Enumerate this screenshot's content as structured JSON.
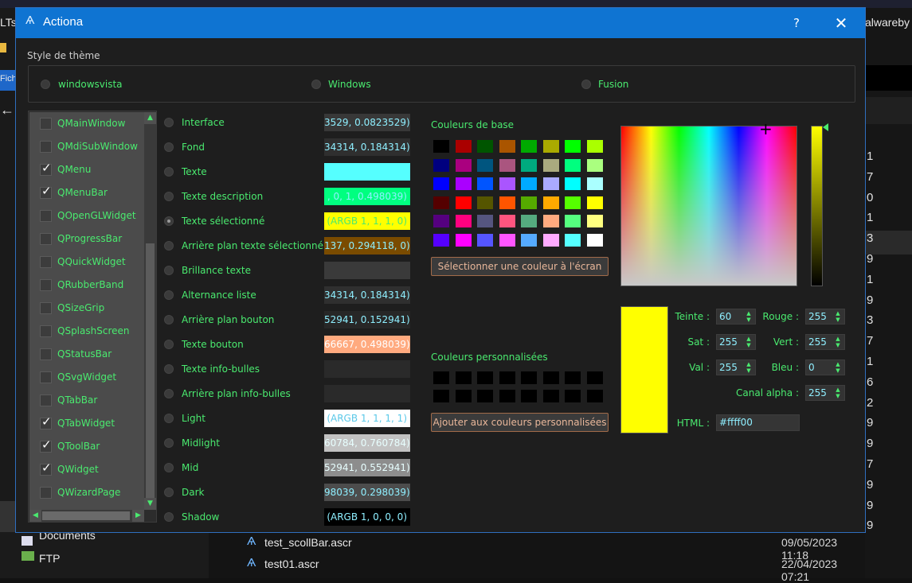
{
  "dialog": {
    "title": "Actiona",
    "help_label": "?",
    "close_label": "✕"
  },
  "theme": {
    "heading": "Style de thème",
    "options": [
      {
        "label": "windowsvista",
        "selected": false
      },
      {
        "label": "Windows",
        "selected": false
      },
      {
        "label": "Fusion",
        "selected": false
      }
    ]
  },
  "widgets": {
    "items": [
      {
        "label": "QMainWindow",
        "checked": false
      },
      {
        "label": "QMdiSubWindow",
        "checked": false
      },
      {
        "label": "QMenu",
        "checked": true
      },
      {
        "label": "QMenuBar",
        "checked": true
      },
      {
        "label": "QOpenGLWidget",
        "checked": false
      },
      {
        "label": "QProgressBar",
        "checked": false
      },
      {
        "label": "QQuickWidget",
        "checked": false
      },
      {
        "label": "QRubberBand",
        "checked": false
      },
      {
        "label": "QSizeGrip",
        "checked": false
      },
      {
        "label": "QSplashScreen",
        "checked": false
      },
      {
        "label": "QStatusBar",
        "checked": false
      },
      {
        "label": "QSvgWidget",
        "checked": false
      },
      {
        "label": "QTabBar",
        "checked": false
      },
      {
        "label": "QTabWidget",
        "checked": true
      },
      {
        "label": "QToolBar",
        "checked": true
      },
      {
        "label": "QWidget",
        "checked": true
      },
      {
        "label": "QWizardPage",
        "checked": false
      }
    ]
  },
  "roles": [
    {
      "label": "Interface",
      "value": "3529, 0.0823529)",
      "bg": "#383838",
      "fg": "#8fefff",
      "selected": false
    },
    {
      "label": "Fond",
      "value": "34314, 0.184314)",
      "bg": "#2f2f2f",
      "fg": "#8fefff",
      "selected": false
    },
    {
      "label": "Texte",
      "value": "",
      "bg": "#55ffff",
      "fg": "#8fefff",
      "selected": false
    },
    {
      "label": "Texte description",
      "value": ", 0, 1, 0.498039)",
      "bg": "#00ff80",
      "fg": "#8fefff",
      "selected": false
    },
    {
      "label": "Texte sélectionné",
      "value": "(ARGB 1, 1, 1, 0)",
      "bg": "#ffff00",
      "fg": "#4aea6f",
      "selected": true
    },
    {
      "label": "Arrière plan texte sélectionné",
      "value": "137, 0.294118, 0)",
      "bg": "#7a4b00",
      "fg": "#8fefff",
      "selected": false
    },
    {
      "label": "Brillance texte",
      "value": "",
      "bg": "#3a3a3a",
      "fg": "#8fefff",
      "selected": false
    },
    {
      "label": "Alternance liste",
      "value": "34314, 0.184314)",
      "bg": "#2f2f2f",
      "fg": "#8fefff",
      "selected": false
    },
    {
      "label": "Arrière plan bouton",
      "value": "52941, 0.152941)",
      "bg": "#272727",
      "fg": "#8fefff",
      "selected": false
    },
    {
      "label": "Texte bouton",
      "value": "66667, 0.498039)",
      "bg": "#ffaa7f",
      "fg": "#ffffff",
      "selected": false
    },
    {
      "label": "Texte info-bulles",
      "value": "",
      "bg": "#2a2a2a",
      "fg": "#8fefff",
      "selected": false
    },
    {
      "label": "Arrière plan info-bulles",
      "value": "",
      "bg": "#2a2a2a",
      "fg": "#8fefff",
      "selected": false
    },
    {
      "label": "Light",
      "value": "(ARGB 1, 1, 1, 1)",
      "bg": "#ffffff",
      "fg": "#5ac8e8",
      "selected": false
    },
    {
      "label": "Midlight",
      "value": "60784, 0.760784)",
      "bg": "#c2c2c2",
      "fg": "#e8ffff",
      "selected": false
    },
    {
      "label": "Mid",
      "value": "52941, 0.552941)",
      "bg": "#8d8d8d",
      "fg": "#e8ffff",
      "selected": false
    },
    {
      "label": "Dark",
      "value": "98039, 0.298039)",
      "bg": "#4c4c4c",
      "fg": "#8fefff",
      "selected": false
    },
    {
      "label": "Shadow",
      "value": "(ARGB 1, 0, 0, 0)",
      "bg": "#000000",
      "fg": "#8fefff",
      "selected": false
    }
  ],
  "colors": {
    "basic_heading": "Couleurs de base",
    "basic": [
      [
        "#000000",
        "#aa0000",
        "#005500",
        "#aa5500",
        "#00aa00",
        "#aaaa00",
        "#00ff00",
        "#aaff00"
      ],
      [
        "#00007f",
        "#aa007f",
        "#00557f",
        "#aa557f",
        "#00aa7f",
        "#aaaa7f",
        "#00ff7f",
        "#aaff7f"
      ],
      [
        "#0000ff",
        "#aa00ff",
        "#0055ff",
        "#aa55ff",
        "#00aaff",
        "#aaaaff",
        "#00ffff",
        "#aaffff"
      ],
      [
        "#550000",
        "#ff0000",
        "#555500",
        "#ff5500",
        "#55aa00",
        "#ffaa00",
        "#55ff00",
        "#ffff00"
      ],
      [
        "#55007f",
        "#ff007f",
        "#55557f",
        "#ff557f",
        "#55aa7f",
        "#ffaa7f",
        "#55ff7f",
        "#ffff7f"
      ],
      [
        "#5500ff",
        "#ff00ff",
        "#5555ff",
        "#ff55ff",
        "#55aaff",
        "#ffaaff",
        "#55ffff",
        "#ffffff"
      ]
    ],
    "pick_button": "Sélectionner une couleur à l'écran",
    "custom_heading": "Couleurs personnalisées",
    "add_button": "Ajouter aux couleurs personnalisées",
    "fields": {
      "hue_label": "Teinte :",
      "hue": "60",
      "sat_label": "Sat :",
      "sat": "255",
      "val_label": "Val :",
      "val": "255",
      "red_label": "Rouge :",
      "red": "255",
      "green_label": "Vert :",
      "green": "255",
      "blue_label": "Bleu :",
      "blue": "0",
      "alpha_label": "Canal alpha :",
      "alpha": "255",
      "html_label": "HTML :",
      "html": "#ffff00"
    }
  },
  "background": {
    "left_label": "LTs",
    "fic_label": "Fich",
    "right_label": "alwareby",
    "numbers": [
      "1",
      "7",
      "0",
      "1",
      "3",
      "9",
      "1",
      "9",
      "3",
      "7",
      "1",
      "6",
      "2",
      "9",
      "9",
      "7",
      "9",
      "9",
      "9"
    ],
    "nav_items": [
      "Documents",
      "FTP"
    ],
    "files": [
      {
        "name": "test_scollBar.ascr",
        "date": "09/05/2023 11:18"
      },
      {
        "name": "test01.ascr",
        "date": "22/04/2023 07:21"
      }
    ]
  }
}
